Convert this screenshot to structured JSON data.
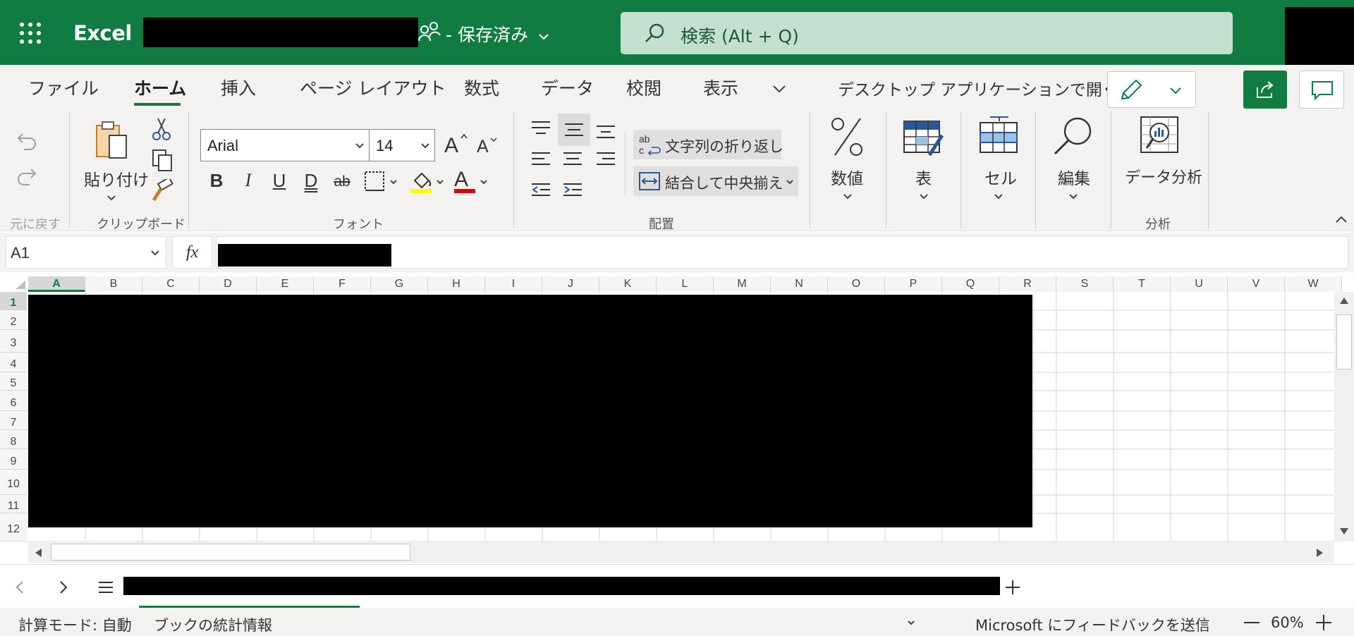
{
  "titlebar": {
    "app_name": "Excel",
    "save_status": "- 保存済み",
    "search_placeholder": "検索 (Alt + Q)"
  },
  "tabs": [
    "ファイル",
    "ホーム",
    "挿入",
    "ページ レイアウト",
    "数式",
    "データ",
    "校閲",
    "表示"
  ],
  "active_tab": "ホーム",
  "open_desktop": "デスクトップ アプリケーションで開く",
  "ribbon": {
    "undo_group_label": "元に戻す",
    "paste_label": "貼り付け",
    "clipboard_group_label": "クリップボード",
    "font_name": "Arial",
    "font_size": "14",
    "font_group_label": "フォント",
    "wrap_text_label": "文字列の折り返し",
    "merge_center_label": "結合して中央揃え",
    "alignment_group_label": "配置",
    "number_label": "数値",
    "table_label": "表",
    "cells_label": "セル",
    "editing_label": "編集",
    "analyze_data_label": "データ分析",
    "analysis_group_label": "分析",
    "highlight_color": "#ffff00",
    "font_color": "#e00000"
  },
  "formula_bar": {
    "name_box": "A1",
    "fx_label": "fx"
  },
  "grid": {
    "columns": [
      "A",
      "B",
      "C",
      "D",
      "E",
      "F",
      "G",
      "H",
      "I",
      "J",
      "K",
      "L",
      "M",
      "N",
      "O",
      "P",
      "Q",
      "R",
      "S",
      "T",
      "U",
      "V",
      "W"
    ],
    "rows": [
      "1",
      "2",
      "3",
      "4",
      "5",
      "6",
      "7",
      "8",
      "9",
      "10",
      "11",
      "12"
    ],
    "selected_cell": "A1"
  },
  "statusbar": {
    "calc_mode": "計算モード: 自動",
    "workbook_stats": "ブックの統計情報",
    "feedback": "Microsoft にフィードバックを送信",
    "zoom": "60%"
  },
  "colors": {
    "brand": "#107c41",
    "search_bg": "#c3dfcf",
    "ribbon_bg": "#f3f2f1"
  }
}
